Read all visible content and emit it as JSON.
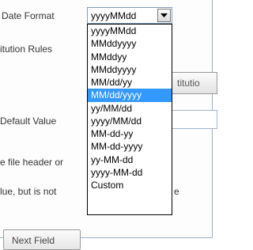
{
  "form": {
    "date_format_label": "Date Format",
    "institution_rules_label": "itution Rules",
    "institution_button_text": "titutio",
    "default_value_label": "Default Value",
    "header_text": "e file header or",
    "note_text_left": "lue, but is not",
    "note_text_right": "e",
    "next_button": "Next Field"
  },
  "date_format_select": {
    "selected_value": "yyyyMMdd",
    "options": [
      "yyyyMMdd",
      "MMddyyyy",
      "MMddyy",
      "MMddyyyy",
      "MM/dd/yy",
      "MM/dd/yyyy",
      "yy/MM/dd",
      "yyyy/MM/dd",
      "MM-dd-yy",
      "MM-dd-yyyy",
      "yy-MM-dd",
      "yyyy-MM-dd",
      "Custom"
    ],
    "highlighted_option": "MM/dd/yyyy",
    "highlight_color": "#3399ff"
  },
  "icons": {
    "dropdown_arrow": "chevron-down-icon"
  }
}
